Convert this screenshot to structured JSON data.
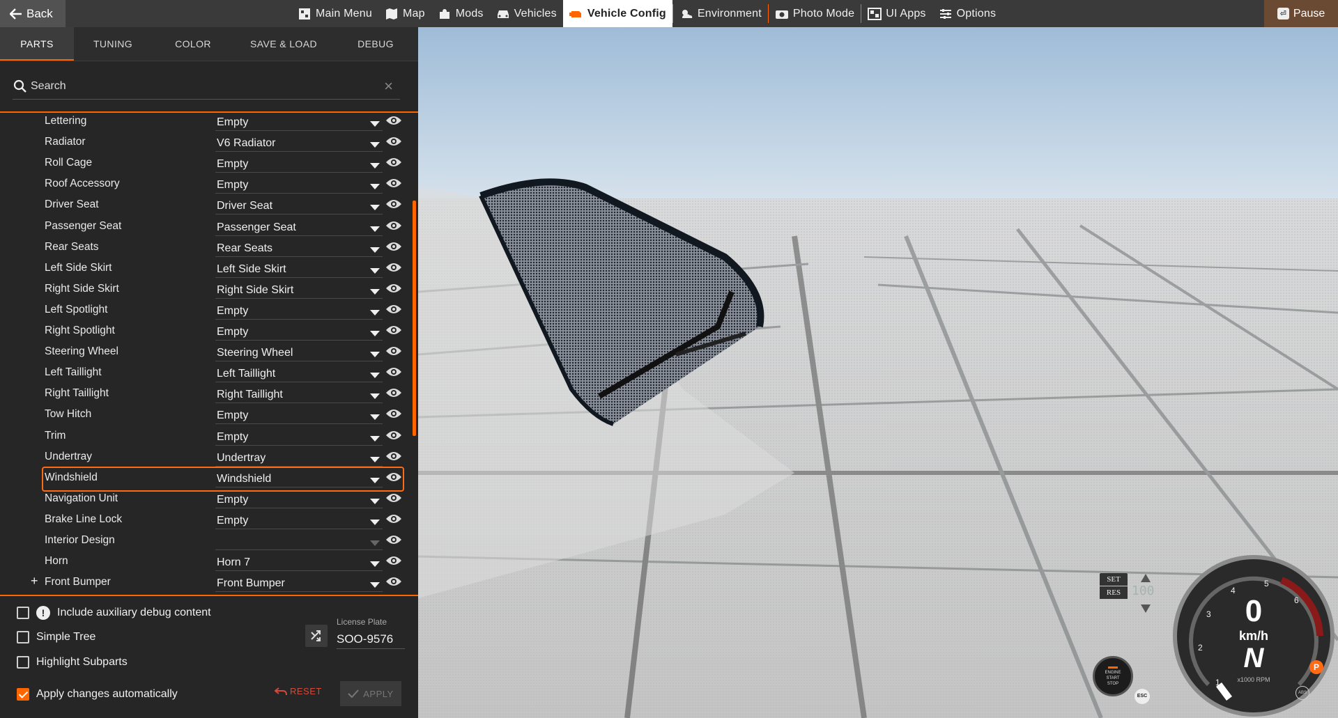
{
  "topbar": {
    "back_label": "Back",
    "nav": [
      {
        "label": "Main Menu",
        "icon": "main-menu-icon"
      },
      {
        "label": "Map",
        "icon": "map-icon"
      },
      {
        "label": "Mods",
        "icon": "puzzle-icon"
      },
      {
        "label": "Vehicles",
        "icon": "car-icon"
      },
      {
        "label": "Vehicle Config",
        "icon": "engine-icon",
        "active": true
      },
      {
        "label": "Environment",
        "icon": "weather-icon"
      },
      {
        "label": "Photo Mode",
        "icon": "camera-icon"
      },
      {
        "label": "UI Apps",
        "icon": "ui-apps-icon"
      },
      {
        "label": "Options",
        "icon": "sliders-icon"
      }
    ],
    "pause_label": "Pause",
    "pause_key": "⏎"
  },
  "tabs": [
    {
      "label": "PARTS",
      "active": true
    },
    {
      "label": "TUNING"
    },
    {
      "label": "COLOR"
    },
    {
      "label": "SAVE & LOAD"
    },
    {
      "label": "DEBUG"
    }
  ],
  "search": {
    "placeholder": "Search"
  },
  "parts": [
    {
      "label": "Lettering",
      "value": "Empty"
    },
    {
      "label": "Radiator",
      "value": "V6 Radiator"
    },
    {
      "label": "Roll Cage",
      "value": "Empty"
    },
    {
      "label": "Roof Accessory",
      "value": "Empty"
    },
    {
      "label": "Driver Seat",
      "value": "Driver Seat"
    },
    {
      "label": "Passenger Seat",
      "value": "Passenger Seat"
    },
    {
      "label": "Rear Seats",
      "value": "Rear Seats"
    },
    {
      "label": "Left Side Skirt",
      "value": "Left Side Skirt"
    },
    {
      "label": "Right Side Skirt",
      "value": "Right Side Skirt"
    },
    {
      "label": "Left Spotlight",
      "value": "Empty"
    },
    {
      "label": "Right Spotlight",
      "value": "Empty"
    },
    {
      "label": "Steering Wheel",
      "value": "Steering Wheel"
    },
    {
      "label": "Left Taillight",
      "value": "Left Taillight"
    },
    {
      "label": "Right Taillight",
      "value": "Right Taillight"
    },
    {
      "label": "Tow Hitch",
      "value": "Empty"
    },
    {
      "label": "Trim",
      "value": "Empty"
    },
    {
      "label": "Undertray",
      "value": "Undertray"
    },
    {
      "label": "Windshield",
      "value": "Windshield",
      "highlighted": true
    },
    {
      "label": "Navigation Unit",
      "value": "Empty"
    },
    {
      "label": "Brake Line Lock",
      "value": "Empty"
    },
    {
      "label": "Interior Design",
      "value": "",
      "disabled": true
    },
    {
      "label": "Horn",
      "value": "Horn 7"
    },
    {
      "label": "Front Bumper",
      "value": "Front Bumper",
      "expandable": true
    }
  ],
  "options": {
    "aux_debug": {
      "label": "Include auxiliary debug content",
      "checked": false
    },
    "simple_tree": {
      "label": "Simple Tree",
      "checked": false
    },
    "highlight_subparts": {
      "label": "Highlight Subparts",
      "checked": false
    },
    "apply_auto": {
      "label": "Apply changes automatically",
      "checked": true
    }
  },
  "license_plate": {
    "label": "License Plate",
    "value": "SOO-9576"
  },
  "buttons": {
    "reset": "RESET",
    "apply": "APPLY"
  },
  "hud": {
    "cruise": {
      "set": "SET",
      "res": "RES",
      "speed_display": "100"
    },
    "engine_button": [
      "ENGINE",
      "START",
      "STOP"
    ],
    "esc": "ESC",
    "speed": "0",
    "speed_unit": "km/h",
    "gear": "N",
    "rpm_unit": "x1000 RPM",
    "abs": "ABS",
    "parking": "P",
    "tach_labels": [
      "1",
      "2",
      "3",
      "4",
      "5",
      "6"
    ]
  },
  "colors": {
    "accent": "#ff6600",
    "panel": "#262626",
    "topbar": "#3a3a3a"
  }
}
